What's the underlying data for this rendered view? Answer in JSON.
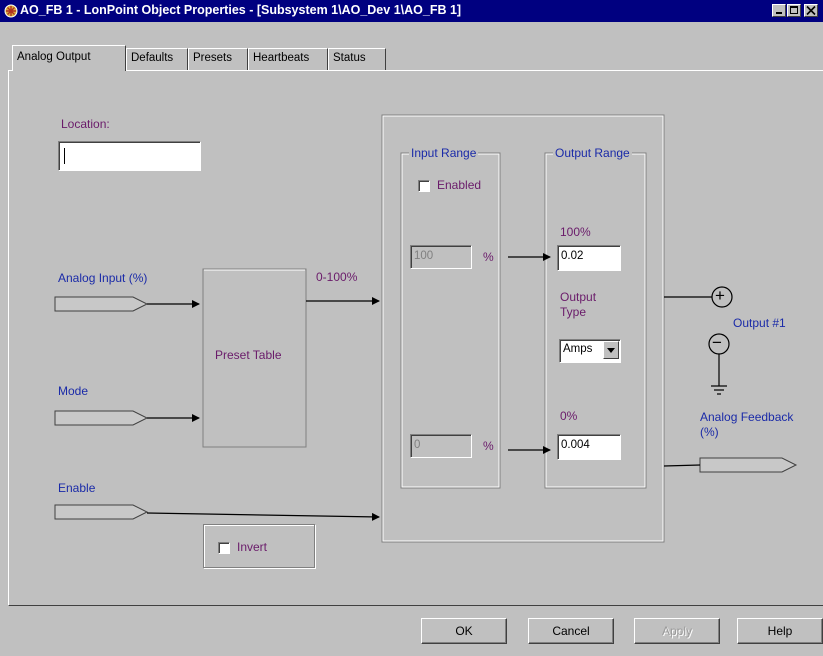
{
  "window": {
    "title": "AO_FB 1 - LonPoint Object Properties - [Subsystem 1\\AO_Dev 1\\AO_FB 1]",
    "icon": "lonpoint-app-icon"
  },
  "tabs": [
    {
      "label": "Analog Output",
      "active": true
    },
    {
      "label": "Defaults",
      "active": false
    },
    {
      "label": "Presets",
      "active": false
    },
    {
      "label": "Heartbeats",
      "active": false
    },
    {
      "label": "Status",
      "active": false
    }
  ],
  "location": {
    "label": "Location:",
    "value": ""
  },
  "inputs": {
    "analog_input": "Analog Input (%)",
    "mode": "Mode",
    "enable": "Enable"
  },
  "preset_table": {
    "label": "Preset Table",
    "range_label": "0-100%"
  },
  "invert": {
    "label": "Invert",
    "checked": false
  },
  "input_range": {
    "label": "Input Range",
    "enabled_label": "Enabled",
    "enabled": false,
    "high_value": "100",
    "low_value": "0",
    "unit": "%"
  },
  "output_range": {
    "label": "Output Range",
    "high_label": "100%",
    "high_value": "0.02",
    "output_type_label": "Output Type",
    "output_type_value": "Amps",
    "low_label": "0%",
    "low_value": "0.004"
  },
  "output": {
    "label": "Output #1",
    "plus_symbol": "+",
    "minus_symbol": "−",
    "feedback_label": "Analog Feedback (%)"
  },
  "buttons": {
    "ok": "OK",
    "cancel": "Cancel",
    "apply": "Apply",
    "help": "Help"
  },
  "colors": {
    "titlebar": "#000080",
    "dialog": "#c0c0c0",
    "label_purple": "#6a1b6a",
    "label_blue": "#1a2aa8"
  }
}
